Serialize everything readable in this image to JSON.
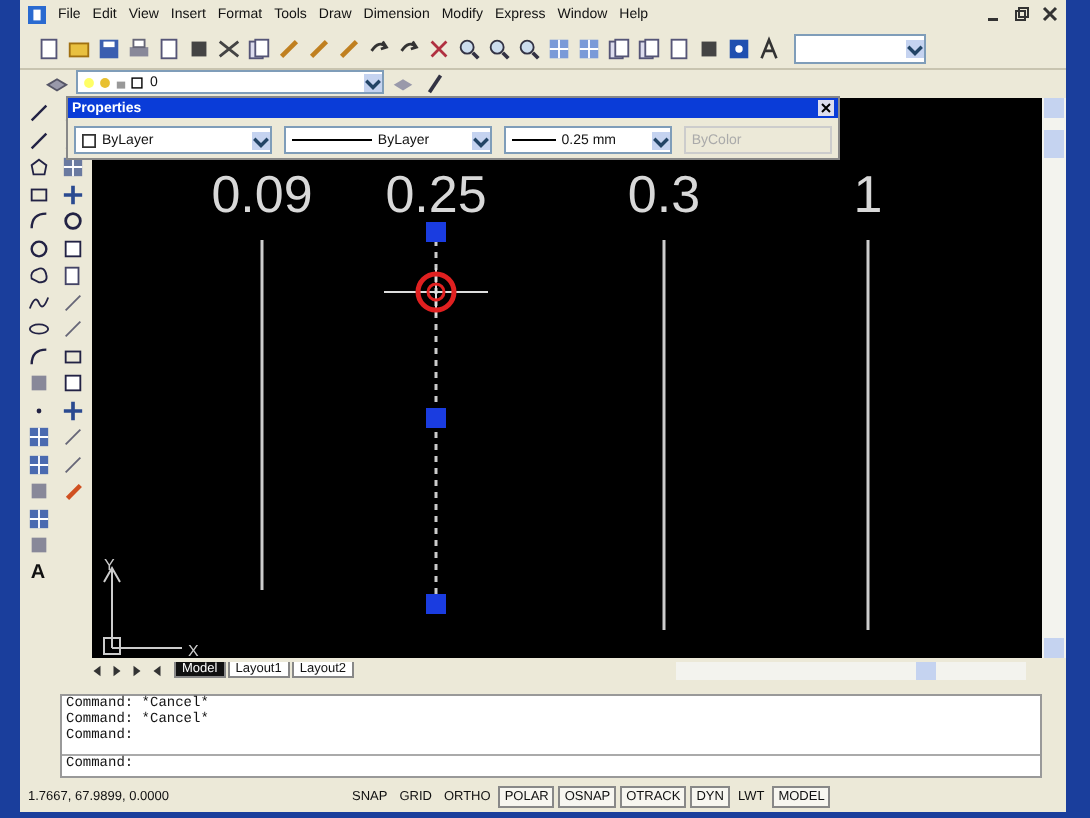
{
  "menu": [
    "File",
    "Edit",
    "View",
    "Insert",
    "Format",
    "Tools",
    "Draw",
    "Dimension",
    "Modify",
    "Express",
    "Window",
    "Help"
  ],
  "layer": {
    "value": "0"
  },
  "properties": {
    "title": "Properties",
    "color_setting": "ByLayer",
    "linetype": "ByLayer",
    "lineweight": "0.25 mm",
    "plot_style": "ByColor",
    "plot_style_disabled": true
  },
  "draw_toolbar": {
    "text_tool": "A"
  },
  "drawing": {
    "lines": [
      {
        "label": "0.09",
        "selected": false
      },
      {
        "label": "0.25",
        "selected": true
      },
      {
        "label": "0.3",
        "selected": false
      },
      {
        "label": "1",
        "selected": false
      }
    ],
    "ucs": {
      "x": "X",
      "y": "Y"
    }
  },
  "layout_tabs": [
    {
      "label": "Model",
      "selected": true
    },
    {
      "label": "Layout1",
      "selected": false
    },
    {
      "label": "Layout2",
      "selected": false
    }
  ],
  "command": {
    "history": [
      "Command:  *Cancel*",
      "Command:  *Cancel*",
      "Command:"
    ],
    "prompt": "Command:"
  },
  "status_bar": {
    "coordinates": "1.7667, 67.9899, 0.0000",
    "toggles": [
      {
        "label": "SNAP",
        "on": false
      },
      {
        "label": "GRID",
        "on": false
      },
      {
        "label": "ORTHO",
        "on": false
      },
      {
        "label": "POLAR",
        "on": true
      },
      {
        "label": "OSNAP",
        "on": true
      },
      {
        "label": "OTRACK",
        "on": true
      },
      {
        "label": "DYN",
        "on": true
      },
      {
        "label": "LWT",
        "on": false
      },
      {
        "label": "MODEL",
        "on": true
      }
    ]
  }
}
